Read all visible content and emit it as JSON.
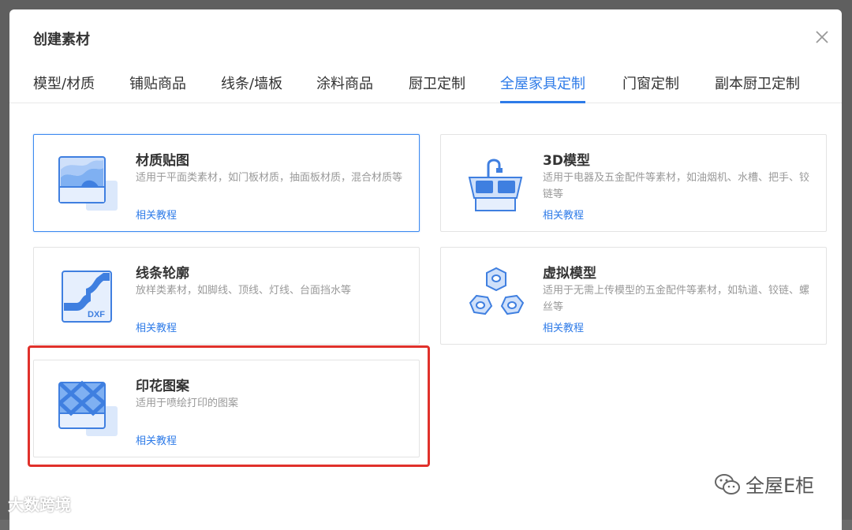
{
  "dialog": {
    "title": "创建素材"
  },
  "tabs": [
    {
      "label": "模型/材质"
    },
    {
      "label": "铺贴商品"
    },
    {
      "label": "线条/墙板"
    },
    {
      "label": "涂料商品"
    },
    {
      "label": "厨卫定制"
    },
    {
      "label": "全屋家具定制",
      "active": true
    },
    {
      "label": "门窗定制"
    },
    {
      "label": "副本厨卫定制"
    }
  ],
  "cards": [
    {
      "title": "材质贴图",
      "desc": "适用于平面类素材，如门板材质，抽面板材质，混合材质等",
      "link": "相关教程",
      "icon": "texture-map-icon"
    },
    {
      "title": "3D模型",
      "desc": "适用于电器及五金配件等素材，如油烟机、水槽、把手、铰链等",
      "link": "相关教程",
      "icon": "sink-model-icon"
    },
    {
      "title": "线条轮廓",
      "desc": "放样类素材，如脚线、顶线、灯线、台面挡水等",
      "link": "相关教程",
      "icon": "dxf-profile-icon",
      "badge": "DXF"
    },
    {
      "title": "虚拟模型",
      "desc": "适用于无需上传模型的五金配件等素材，如轨道、铰链、螺丝等",
      "link": "相关教程",
      "icon": "hex-nuts-icon"
    },
    {
      "title": "印花图案",
      "desc": "适用于喷绘打印的图案",
      "link": "相关教程",
      "icon": "print-pattern-icon"
    }
  ],
  "watermarks": {
    "left": "大数跨境",
    "right": "全屋E柜"
  },
  "colors": {
    "accent": "#2e7be8",
    "highlight": "#e0312b"
  }
}
